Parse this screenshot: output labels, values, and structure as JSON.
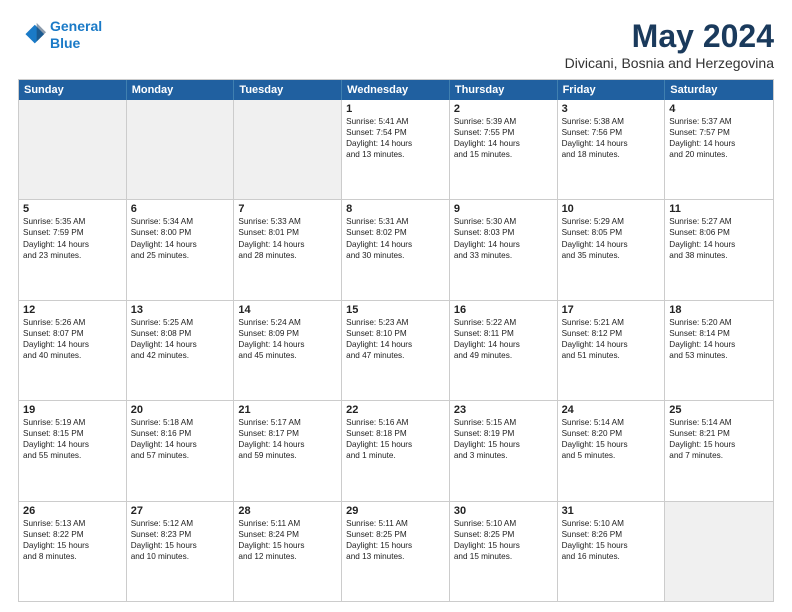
{
  "header": {
    "logo_line1": "General",
    "logo_line2": "Blue",
    "title": "May 2024",
    "subtitle": "Divicani, Bosnia and Herzegovina"
  },
  "days": [
    "Sunday",
    "Monday",
    "Tuesday",
    "Wednesday",
    "Thursday",
    "Friday",
    "Saturday"
  ],
  "rows": [
    [
      {
        "day": "",
        "lines": [],
        "shaded": true
      },
      {
        "day": "",
        "lines": [],
        "shaded": true
      },
      {
        "day": "",
        "lines": [],
        "shaded": true
      },
      {
        "day": "1",
        "lines": [
          "Sunrise: 5:41 AM",
          "Sunset: 7:54 PM",
          "Daylight: 14 hours",
          "and 13 minutes."
        ]
      },
      {
        "day": "2",
        "lines": [
          "Sunrise: 5:39 AM",
          "Sunset: 7:55 PM",
          "Daylight: 14 hours",
          "and 15 minutes."
        ]
      },
      {
        "day": "3",
        "lines": [
          "Sunrise: 5:38 AM",
          "Sunset: 7:56 PM",
          "Daylight: 14 hours",
          "and 18 minutes."
        ]
      },
      {
        "day": "4",
        "lines": [
          "Sunrise: 5:37 AM",
          "Sunset: 7:57 PM",
          "Daylight: 14 hours",
          "and 20 minutes."
        ]
      }
    ],
    [
      {
        "day": "5",
        "lines": [
          "Sunrise: 5:35 AM",
          "Sunset: 7:59 PM",
          "Daylight: 14 hours",
          "and 23 minutes."
        ]
      },
      {
        "day": "6",
        "lines": [
          "Sunrise: 5:34 AM",
          "Sunset: 8:00 PM",
          "Daylight: 14 hours",
          "and 25 minutes."
        ]
      },
      {
        "day": "7",
        "lines": [
          "Sunrise: 5:33 AM",
          "Sunset: 8:01 PM",
          "Daylight: 14 hours",
          "and 28 minutes."
        ]
      },
      {
        "day": "8",
        "lines": [
          "Sunrise: 5:31 AM",
          "Sunset: 8:02 PM",
          "Daylight: 14 hours",
          "and 30 minutes."
        ]
      },
      {
        "day": "9",
        "lines": [
          "Sunrise: 5:30 AM",
          "Sunset: 8:03 PM",
          "Daylight: 14 hours",
          "and 33 minutes."
        ]
      },
      {
        "day": "10",
        "lines": [
          "Sunrise: 5:29 AM",
          "Sunset: 8:05 PM",
          "Daylight: 14 hours",
          "and 35 minutes."
        ]
      },
      {
        "day": "11",
        "lines": [
          "Sunrise: 5:27 AM",
          "Sunset: 8:06 PM",
          "Daylight: 14 hours",
          "and 38 minutes."
        ]
      }
    ],
    [
      {
        "day": "12",
        "lines": [
          "Sunrise: 5:26 AM",
          "Sunset: 8:07 PM",
          "Daylight: 14 hours",
          "and 40 minutes."
        ]
      },
      {
        "day": "13",
        "lines": [
          "Sunrise: 5:25 AM",
          "Sunset: 8:08 PM",
          "Daylight: 14 hours",
          "and 42 minutes."
        ]
      },
      {
        "day": "14",
        "lines": [
          "Sunrise: 5:24 AM",
          "Sunset: 8:09 PM",
          "Daylight: 14 hours",
          "and 45 minutes."
        ]
      },
      {
        "day": "15",
        "lines": [
          "Sunrise: 5:23 AM",
          "Sunset: 8:10 PM",
          "Daylight: 14 hours",
          "and 47 minutes."
        ]
      },
      {
        "day": "16",
        "lines": [
          "Sunrise: 5:22 AM",
          "Sunset: 8:11 PM",
          "Daylight: 14 hours",
          "and 49 minutes."
        ]
      },
      {
        "day": "17",
        "lines": [
          "Sunrise: 5:21 AM",
          "Sunset: 8:12 PM",
          "Daylight: 14 hours",
          "and 51 minutes."
        ]
      },
      {
        "day": "18",
        "lines": [
          "Sunrise: 5:20 AM",
          "Sunset: 8:14 PM",
          "Daylight: 14 hours",
          "and 53 minutes."
        ]
      }
    ],
    [
      {
        "day": "19",
        "lines": [
          "Sunrise: 5:19 AM",
          "Sunset: 8:15 PM",
          "Daylight: 14 hours",
          "and 55 minutes."
        ]
      },
      {
        "day": "20",
        "lines": [
          "Sunrise: 5:18 AM",
          "Sunset: 8:16 PM",
          "Daylight: 14 hours",
          "and 57 minutes."
        ]
      },
      {
        "day": "21",
        "lines": [
          "Sunrise: 5:17 AM",
          "Sunset: 8:17 PM",
          "Daylight: 14 hours",
          "and 59 minutes."
        ]
      },
      {
        "day": "22",
        "lines": [
          "Sunrise: 5:16 AM",
          "Sunset: 8:18 PM",
          "Daylight: 15 hours",
          "and 1 minute."
        ]
      },
      {
        "day": "23",
        "lines": [
          "Sunrise: 5:15 AM",
          "Sunset: 8:19 PM",
          "Daylight: 15 hours",
          "and 3 minutes."
        ]
      },
      {
        "day": "24",
        "lines": [
          "Sunrise: 5:14 AM",
          "Sunset: 8:20 PM",
          "Daylight: 15 hours",
          "and 5 minutes."
        ]
      },
      {
        "day": "25",
        "lines": [
          "Sunrise: 5:14 AM",
          "Sunset: 8:21 PM",
          "Daylight: 15 hours",
          "and 7 minutes."
        ]
      }
    ],
    [
      {
        "day": "26",
        "lines": [
          "Sunrise: 5:13 AM",
          "Sunset: 8:22 PM",
          "Daylight: 15 hours",
          "and 8 minutes."
        ]
      },
      {
        "day": "27",
        "lines": [
          "Sunrise: 5:12 AM",
          "Sunset: 8:23 PM",
          "Daylight: 15 hours",
          "and 10 minutes."
        ]
      },
      {
        "day": "28",
        "lines": [
          "Sunrise: 5:11 AM",
          "Sunset: 8:24 PM",
          "Daylight: 15 hours",
          "and 12 minutes."
        ]
      },
      {
        "day": "29",
        "lines": [
          "Sunrise: 5:11 AM",
          "Sunset: 8:25 PM",
          "Daylight: 15 hours",
          "and 13 minutes."
        ]
      },
      {
        "day": "30",
        "lines": [
          "Sunrise: 5:10 AM",
          "Sunset: 8:25 PM",
          "Daylight: 15 hours",
          "and 15 minutes."
        ]
      },
      {
        "day": "31",
        "lines": [
          "Sunrise: 5:10 AM",
          "Sunset: 8:26 PM",
          "Daylight: 15 hours",
          "and 16 minutes."
        ]
      },
      {
        "day": "",
        "lines": [],
        "shaded": true
      }
    ]
  ]
}
